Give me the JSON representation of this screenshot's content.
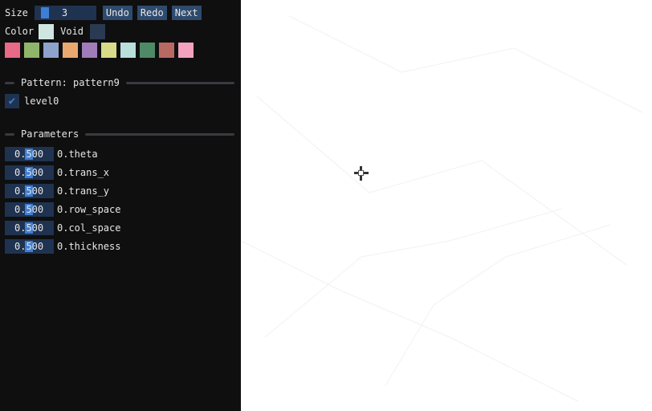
{
  "toolbar": {
    "size_label": "Size",
    "size_value": "3",
    "undo_label": "Undo",
    "redo_label": "Redo",
    "next_label": "Next",
    "color_label": "Color",
    "void_label": "Void",
    "color_value": "#cfe6e0",
    "void_value": "#2a3a52"
  },
  "palette": [
    "#e86a86",
    "#8fb56a",
    "#8ea3cc",
    "#e9a86f",
    "#a07cb8",
    "#d8dc88",
    "#b9dfd9",
    "#4f8a67",
    "#b86a62",
    "#f2a2bf"
  ],
  "pattern_section": {
    "title": "Pattern: pattern9",
    "level_label": "level0",
    "level_checked": true
  },
  "parameters_section": {
    "title": "Parameters",
    "items": [
      {
        "value": "0.500",
        "label": "0.theta"
      },
      {
        "value": "0.500",
        "label": "0.trans_x"
      },
      {
        "value": "0.500",
        "label": "0.trans_y"
      },
      {
        "value": "0.500",
        "label": "0.row_space"
      },
      {
        "value": "0.500",
        "label": "0.col_space"
      },
      {
        "value": "0.500",
        "label": "0.thickness"
      }
    ]
  },
  "icons": {
    "cursor": "move-cursor-icon",
    "check": "checkmark-icon"
  }
}
